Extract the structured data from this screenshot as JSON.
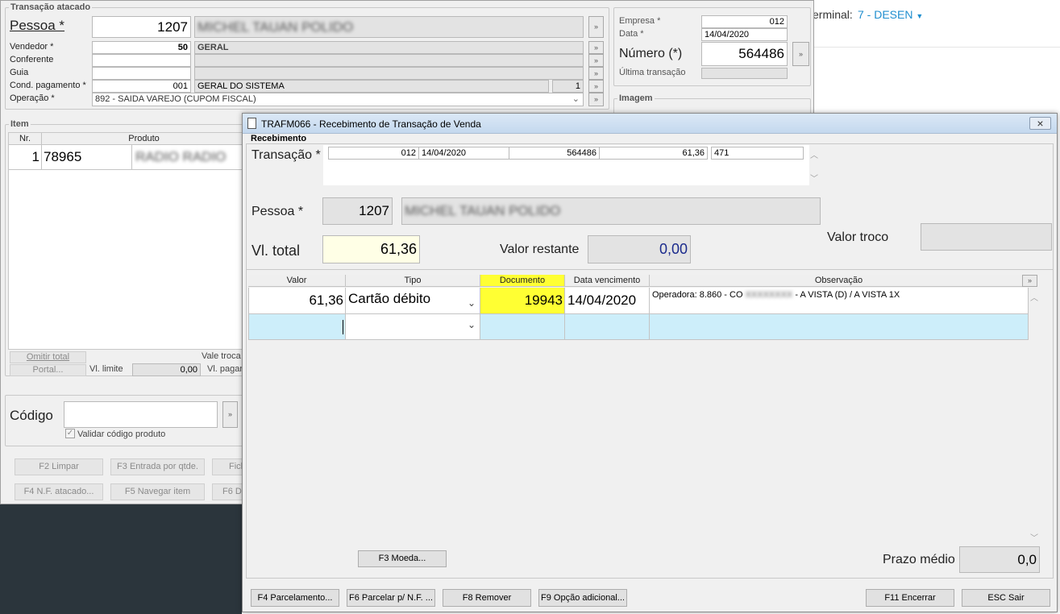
{
  "bg": {
    "terminal_label": "erminal:",
    "terminal_value": "7 - DESEN",
    "terminal_color": "#1f8ecf"
  },
  "main": {
    "group_title": "Transação atacado",
    "pessoa_label": "Pessoa *",
    "pessoa_code": "1207",
    "pessoa_name": "MICHEL TAUAN POLIDO",
    "vendedor_label": "Vendedor *",
    "vendedor_code": "50",
    "vendedor_name": "GERAL",
    "conferente_label": "Conferente",
    "guia_label": "Guia",
    "cond_label": "Cond. pagamento *",
    "cond_code": "001",
    "cond_name": "GERAL DO SISTEMA",
    "cond_num": "1",
    "operacao_label": "Operação *",
    "operacao_value": "892 - SAIDA VAREJO (CUPOM FISCAL)",
    "empresa_label": "Empresa *",
    "empresa_value": "012",
    "data_label": "Data *",
    "data_value": "14/04/2020",
    "numero_label": "Número (*)",
    "numero_value": "564486",
    "ultima_label": "Última transação",
    "imagem_label": "Imagem",
    "item_label": "Item",
    "item_col_nr": "Nr.",
    "item_col_produto": "Produto",
    "item_row_nr": "1",
    "item_row_code": "78965",
    "item_row_desc": "RADIO RADIO",
    "omitir_label": "Omitir total",
    "portal_label": "Portal...",
    "vl_limite_label": "Vl. limite",
    "vl_limite_value": "0,00",
    "vale_troca_label": "Vale troca",
    "vl_pagar_label": "Vl. pagar",
    "codigo_label": "Código",
    "validar_label": "Validar código produto",
    "f2": "F2 Limpar",
    "f3": "F3 Entrada por qtde.",
    "fx": "Fich",
    "f4": "F4 N.F. atacado...",
    "f5": "F5 Navegar item",
    "f6": "F6 De"
  },
  "dialog": {
    "title": "TRAFM066 - Recebimento de Transação de Venda",
    "close": "×",
    "section": "Recebimento",
    "transacao_label": "Transação *",
    "trans_empresa": "012",
    "trans_data": "14/04/2020",
    "trans_numero": "564486",
    "trans_valor": "61,36",
    "trans_extra": "471",
    "pessoa_label": "Pessoa *",
    "pessoa_code": "1207",
    "pessoa_name": "MICHEL TAUAN POLIDO",
    "vl_total_label": "Vl. total",
    "vl_total_value": "61,36",
    "valor_restante_label": "Valor restante",
    "valor_restante_value": "0,00",
    "valor_troco_label": "Valor troco",
    "grid": {
      "columns": [
        "Valor",
        "Tipo",
        "Documento",
        "Data vencimento",
        "Observação"
      ],
      "row": {
        "valor": "61,36",
        "tipo": "Cartão débito",
        "documento": "19943",
        "vencimento": "14/04/2020",
        "obs_a": "Operadora: 8.860 - CO",
        "obs_blur": "XXXXXXXX",
        "obs_b": "- A VISTA (D) / A VISTA 1X"
      }
    },
    "f3_moeda": "F3 Moeda...",
    "prazo_label": "Prazo médio",
    "prazo_value": "0,0",
    "buttons": {
      "f4": "F4 Parcelamento...",
      "f6": "F6 Parcelar p/ N.F. ...",
      "f8": "F8 Remover",
      "f9": "F9 Opção adicional...",
      "f11": "F11 Encerrar",
      "esc": "ESC Sair"
    },
    "colors": {
      "highlight_yellow": "#ffff33",
      "total_bg": "#ffffe6",
      "new_row": "#cdeefa",
      "blue_text": "#1a2a8c"
    }
  }
}
